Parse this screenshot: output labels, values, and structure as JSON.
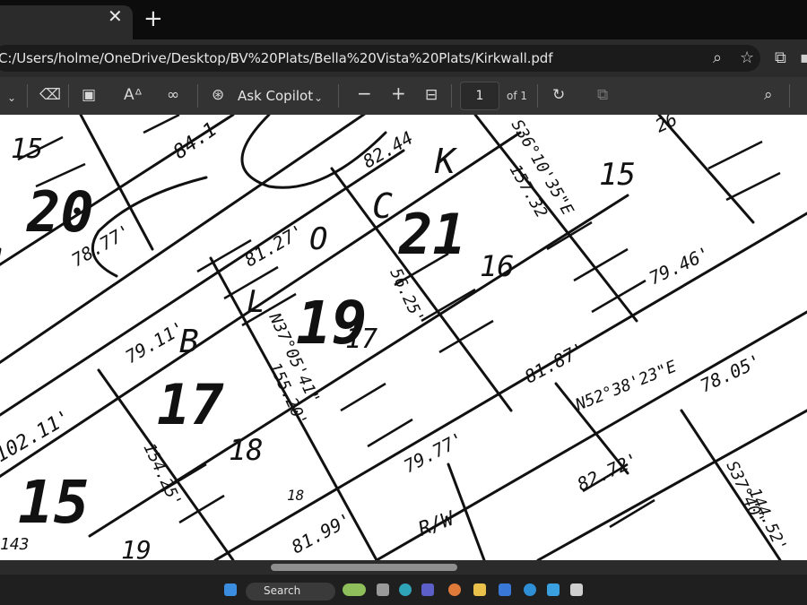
{
  "browser": {
    "url": "C:/Users/holme/OneDrive/Desktop/BV%20Plats/Bella%20Vista%20Plats/Kirkwall.pdf",
    "tab_close": "✕",
    "new_tab": "+"
  },
  "toolbar": {
    "copilot_label": "Ask Copilot",
    "page_number": "1",
    "page_of": "of 1",
    "zoom_out": "−",
    "zoom_in": "+"
  },
  "taskbar": {
    "search_label": "Search"
  },
  "plat": {
    "labels": [
      "15",
      "20",
      "84.1",
      "82.44",
      "C",
      "K",
      "S36°10'35\"E",
      "26",
      "15",
      "157.32",
      "78.77'",
      "81.27'",
      "O",
      "21",
      "16",
      "19",
      "79.46'",
      "79.11'",
      "B",
      "L",
      "N37°05'41\"",
      "56.25'",
      "17",
      "81.87'",
      "N52°38'23\"E",
      "78.05'",
      "17",
      "155.20'",
      "18",
      "79.77'",
      "82.72'",
      "S37°40'",
      "102.11'",
      "15",
      "154.25'",
      "18",
      "R/W",
      "81.99'",
      "144.52'",
      "19",
      "143"
    ]
  }
}
